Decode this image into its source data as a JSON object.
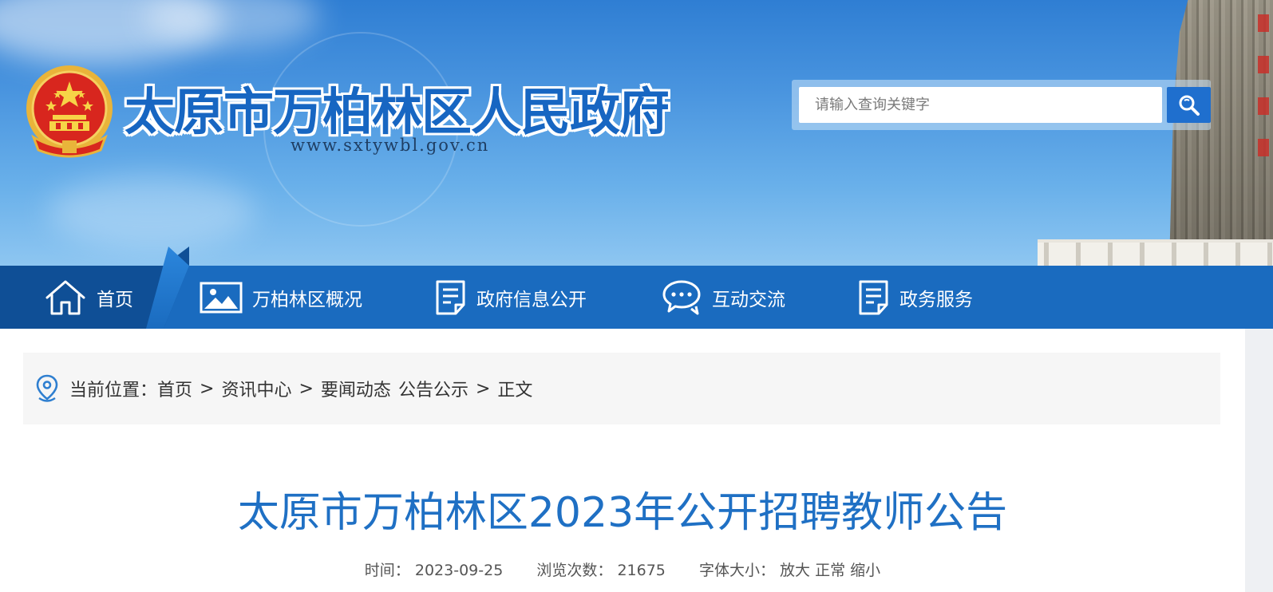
{
  "header": {
    "site_title": "太原市万柏林区人民政府",
    "site_url": "www.sxtywbl.gov.cn",
    "search": {
      "placeholder": "请输入查询关键字",
      "button_icon": "search-icon"
    },
    "emblem_icon": "national-emblem-icon"
  },
  "nav": {
    "items": [
      {
        "label": "首页",
        "icon": "home-icon"
      },
      {
        "label": "万柏林区概况",
        "icon": "picture-icon"
      },
      {
        "label": "政府信息公开",
        "icon": "document-icon"
      },
      {
        "label": "互动交流",
        "icon": "chat-icon"
      },
      {
        "label": "政务服务",
        "icon": "document-icon"
      }
    ]
  },
  "breadcrumb": {
    "prefix": "当前位置：",
    "items": [
      "首页",
      "资讯中心",
      "要闻动态",
      "公告公示",
      "正文"
    ],
    "separator": ">"
  },
  "article": {
    "title": "太原市万柏林区2023年公开招聘教师公告",
    "time_label": "时间：",
    "time_value": "2023-09-25",
    "views_label": "浏览次数：",
    "views_value": "21675",
    "font_size_label": "字体大小：",
    "font_size_options": [
      "放大",
      "正常",
      "缩小"
    ]
  },
  "colors": {
    "nav_bg": "#1a6bbf",
    "nav_home_bg": "#0f4f96",
    "title_blue": "#1f70c4",
    "breadcrumb_bg": "#f6f6f6"
  }
}
